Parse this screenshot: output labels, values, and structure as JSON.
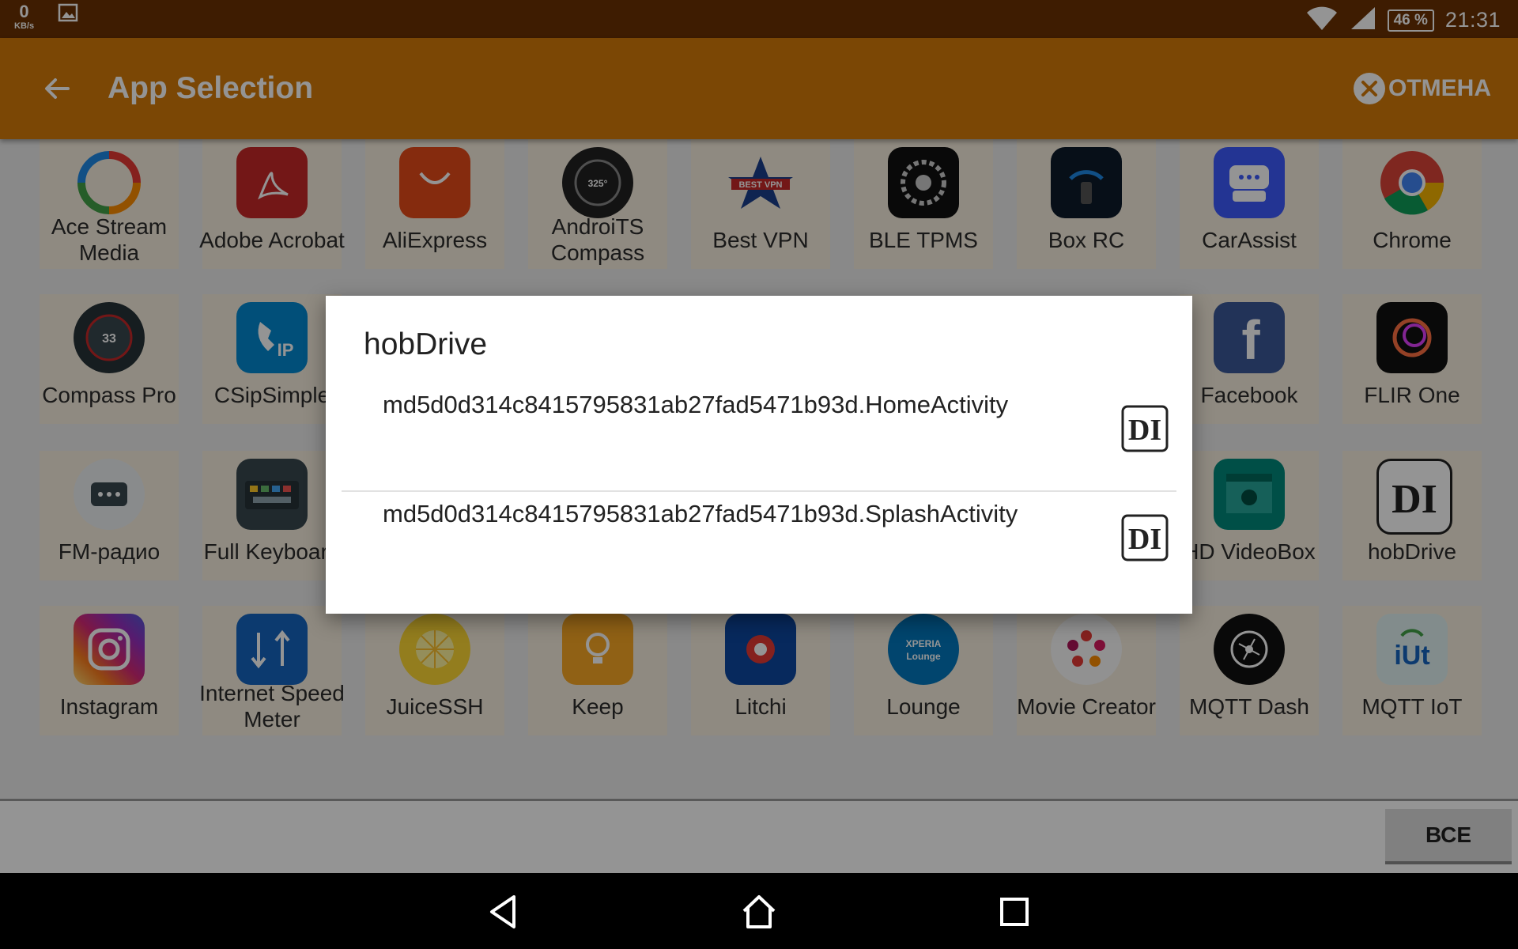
{
  "status_bar": {
    "net_value": "0",
    "net_unit": "KB/s",
    "battery": "46 %",
    "time": "21:31"
  },
  "app_bar": {
    "title": "App Selection",
    "cancel_label": "ОТМЕНА"
  },
  "apps": [
    {
      "label": "Ace Stream Media",
      "icon": "ace-stream"
    },
    {
      "label": "Adobe Acrobat",
      "icon": "adobe-acrobat"
    },
    {
      "label": "AliExpress",
      "icon": "aliexpress"
    },
    {
      "label": "AndroiTS Compass",
      "icon": "androits-compass"
    },
    {
      "label": "Best VPN",
      "icon": "best-vpn"
    },
    {
      "label": "BLE TPMS",
      "icon": "ble-tpms"
    },
    {
      "label": "Box RC",
      "icon": "box-rc"
    },
    {
      "label": "CarAssist",
      "icon": "carassist"
    },
    {
      "label": "Chrome",
      "icon": "chrome"
    },
    {
      "label": "Compass Pro",
      "icon": "compass-pro"
    },
    {
      "label": "CSipSimple",
      "icon": "csipsimple"
    },
    {
      "label": "",
      "icon": ""
    },
    {
      "label": "",
      "icon": ""
    },
    {
      "label": "",
      "icon": ""
    },
    {
      "label": "",
      "icon": ""
    },
    {
      "label": "",
      "icon": ""
    },
    {
      "label": "Facebook",
      "icon": "facebook"
    },
    {
      "label": "FLIR One",
      "icon": "flir-one"
    },
    {
      "label": "FM-радио",
      "icon": "fm-radio"
    },
    {
      "label": "Full Keyboard",
      "icon": "full-keyboard"
    },
    {
      "label": "",
      "icon": ""
    },
    {
      "label": "",
      "icon": ""
    },
    {
      "label": "",
      "icon": ""
    },
    {
      "label": "",
      "icon": ""
    },
    {
      "label": "",
      "icon": ""
    },
    {
      "label": "HD VideoBox",
      "icon": "hd-videobox"
    },
    {
      "label": "hobDrive",
      "icon": "hobdrive"
    },
    {
      "label": "Instagram",
      "icon": "instagram"
    },
    {
      "label": "Internet Speed Meter",
      "icon": "internet-speed-meter"
    },
    {
      "label": "JuiceSSH",
      "icon": "juicessh"
    },
    {
      "label": "Keep",
      "icon": "keep"
    },
    {
      "label": "Litchi",
      "icon": "litchi"
    },
    {
      "label": "Lounge",
      "icon": "lounge"
    },
    {
      "label": "Movie Creator",
      "icon": "movie-creator"
    },
    {
      "label": "MQTT Dash",
      "icon": "mqtt-dash"
    },
    {
      "label": "MQTT IoT",
      "icon": "mqtt-iot"
    }
  ],
  "colors": {
    "status_bar": "#6b3103",
    "app_bar": "#d47a0a"
  },
  "bottom_bar": {
    "all_label": "ВСЕ"
  },
  "dialog": {
    "title": "hobDrive",
    "activities": [
      {
        "name": "md5d0d314c8415795831ab27fad5471b93d.HomeActivity",
        "icon": "hobdrive"
      },
      {
        "name": "md5d0d314c8415795831ab27fad5471b93d.SplashActivity",
        "icon": "hobdrive"
      }
    ]
  }
}
